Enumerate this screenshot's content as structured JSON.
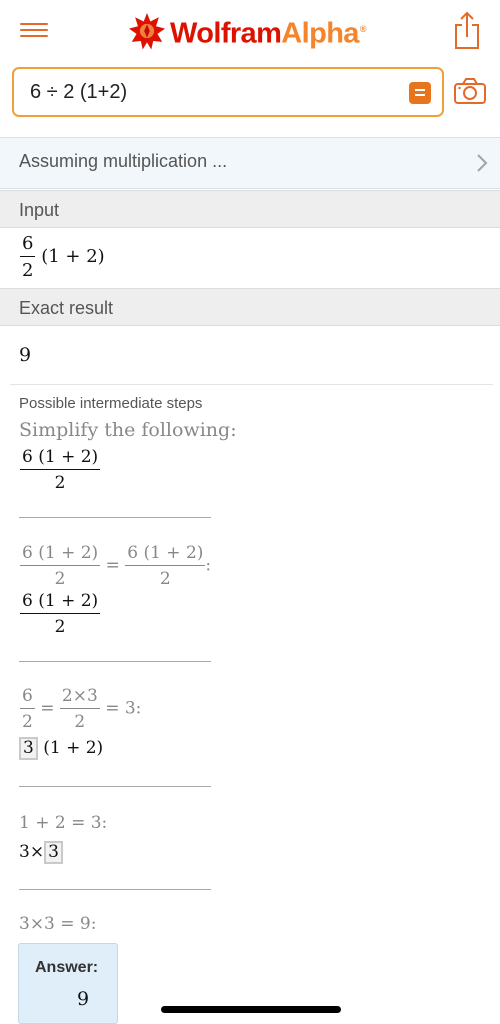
{
  "header": {
    "logo_wolfram": "Wolfram",
    "logo_alpha": "Alpha",
    "logo_tm": "®",
    "icons": [
      "menu-icon",
      "wolfram-star-icon",
      "share-icon",
      "camera-icon",
      "equals-icon",
      "chevron-right-icon"
    ],
    "brand_red": "#dd1100",
    "brand_orange": "#f5842b"
  },
  "search": {
    "value": "6 ÷ 2 (1+2)"
  },
  "assumption": {
    "text": "Assuming multiplication ..."
  },
  "input_pod": {
    "title": "Input",
    "numerator": "6",
    "denominator": "2",
    "rest": "(1 + 2)"
  },
  "result_pod": {
    "title": "Exact result",
    "value": "9",
    "steps_label": "Possible intermediate steps",
    "steps_intro": "Simplify the following:",
    "step0_num": "6 (1 + 2)",
    "step0_den": "2",
    "step1_lhs_num": "6 (1 + 2)",
    "step1_lhs_den": "2",
    "step1_eq": "=",
    "step1_rhs_num": "6 (1 + 2)",
    "step1_rhs_den": "2",
    "step1_colon": ":",
    "step1_res_num": "6 (1 + 2)",
    "step1_res_den": "2",
    "step2_a_num": "6",
    "step2_a_den": "2",
    "step2_eq1": "=",
    "step2_b_num": "2×3",
    "step2_b_den": "2",
    "step2_tail": "= 3:",
    "step2_res_boxed": "3",
    "step2_res_rest": "(1 + 2)",
    "step3_text": "1 + 2 = 3:",
    "step3_res_pre": "3×",
    "step3_res_boxed": "3",
    "step4_text": "3×3 = 9:",
    "answer_label": "Answer:",
    "answer_value": "9"
  }
}
